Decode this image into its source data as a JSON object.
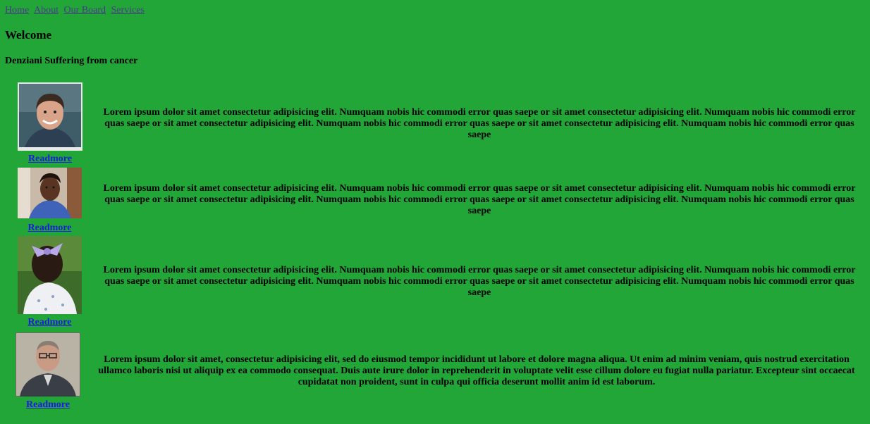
{
  "nav": {
    "links": [
      "Home",
      "About",
      "Our Board",
      "Services"
    ]
  },
  "header": {
    "title": "Welcome",
    "subtitle": "Denziani Suffering from cancer"
  },
  "rows": [
    {
      "readmore": "Readmore",
      "text": "Lorem ipsum dolor sit amet consectetur adipisicing elit. Numquam nobis hic commodi error quas saepe or sit amet consectetur adipisicing elit. Numquam nobis hic commodi error quas saepe or sit amet consectetur adipisicing elit. Numquam nobis hic commodi error quas saepe or sit amet consectetur adipisicing elit. Numquam nobis hic commodi error quas saepe"
    },
    {
      "readmore": "Readmore",
      "text": "Lorem ipsum dolor sit amet consectetur adipisicing elit. Numquam nobis hic commodi error quas saepe or sit amet consectetur adipisicing elit. Numquam nobis hic commodi error quas saepe or sit amet consectetur adipisicing elit. Numquam nobis hic commodi error quas saepe or sit amet consectetur adipisicing elit. Numquam nobis hic commodi error quas saepe"
    },
    {
      "readmore": "Readmore",
      "text": "Lorem ipsum dolor sit amet consectetur adipisicing elit. Numquam nobis hic commodi error quas saepe or sit amet consectetur adipisicing elit. Numquam nobis hic commodi error quas saepe or sit amet consectetur adipisicing elit. Numquam nobis hic commodi error quas saepe or sit amet consectetur adipisicing elit. Numquam nobis hic commodi error quas saepe"
    },
    {
      "readmore": "Readmore",
      "text": "Lorem ipsum dolor sit amet, consectetur adipisicing elit, sed do eiusmod tempor incididunt ut labore et dolore magna aliqua. Ut enim ad minim veniam, quis nostrud exercitation ullamco laboris nisi ut aliquip ex ea commodo consequat. Duis aute irure dolor in reprehenderit in voluptate velit esse cillum dolore eu fugiat nulla pariatur. Excepteur sint occaecat cupidatat non proident, sunt in culpa qui officia deserunt mollit anim id est laborum."
    }
  ],
  "colors": {
    "background": "#21a637",
    "nav_link": "#4a3a8a",
    "readmore_link": "#1c1ce0"
  }
}
